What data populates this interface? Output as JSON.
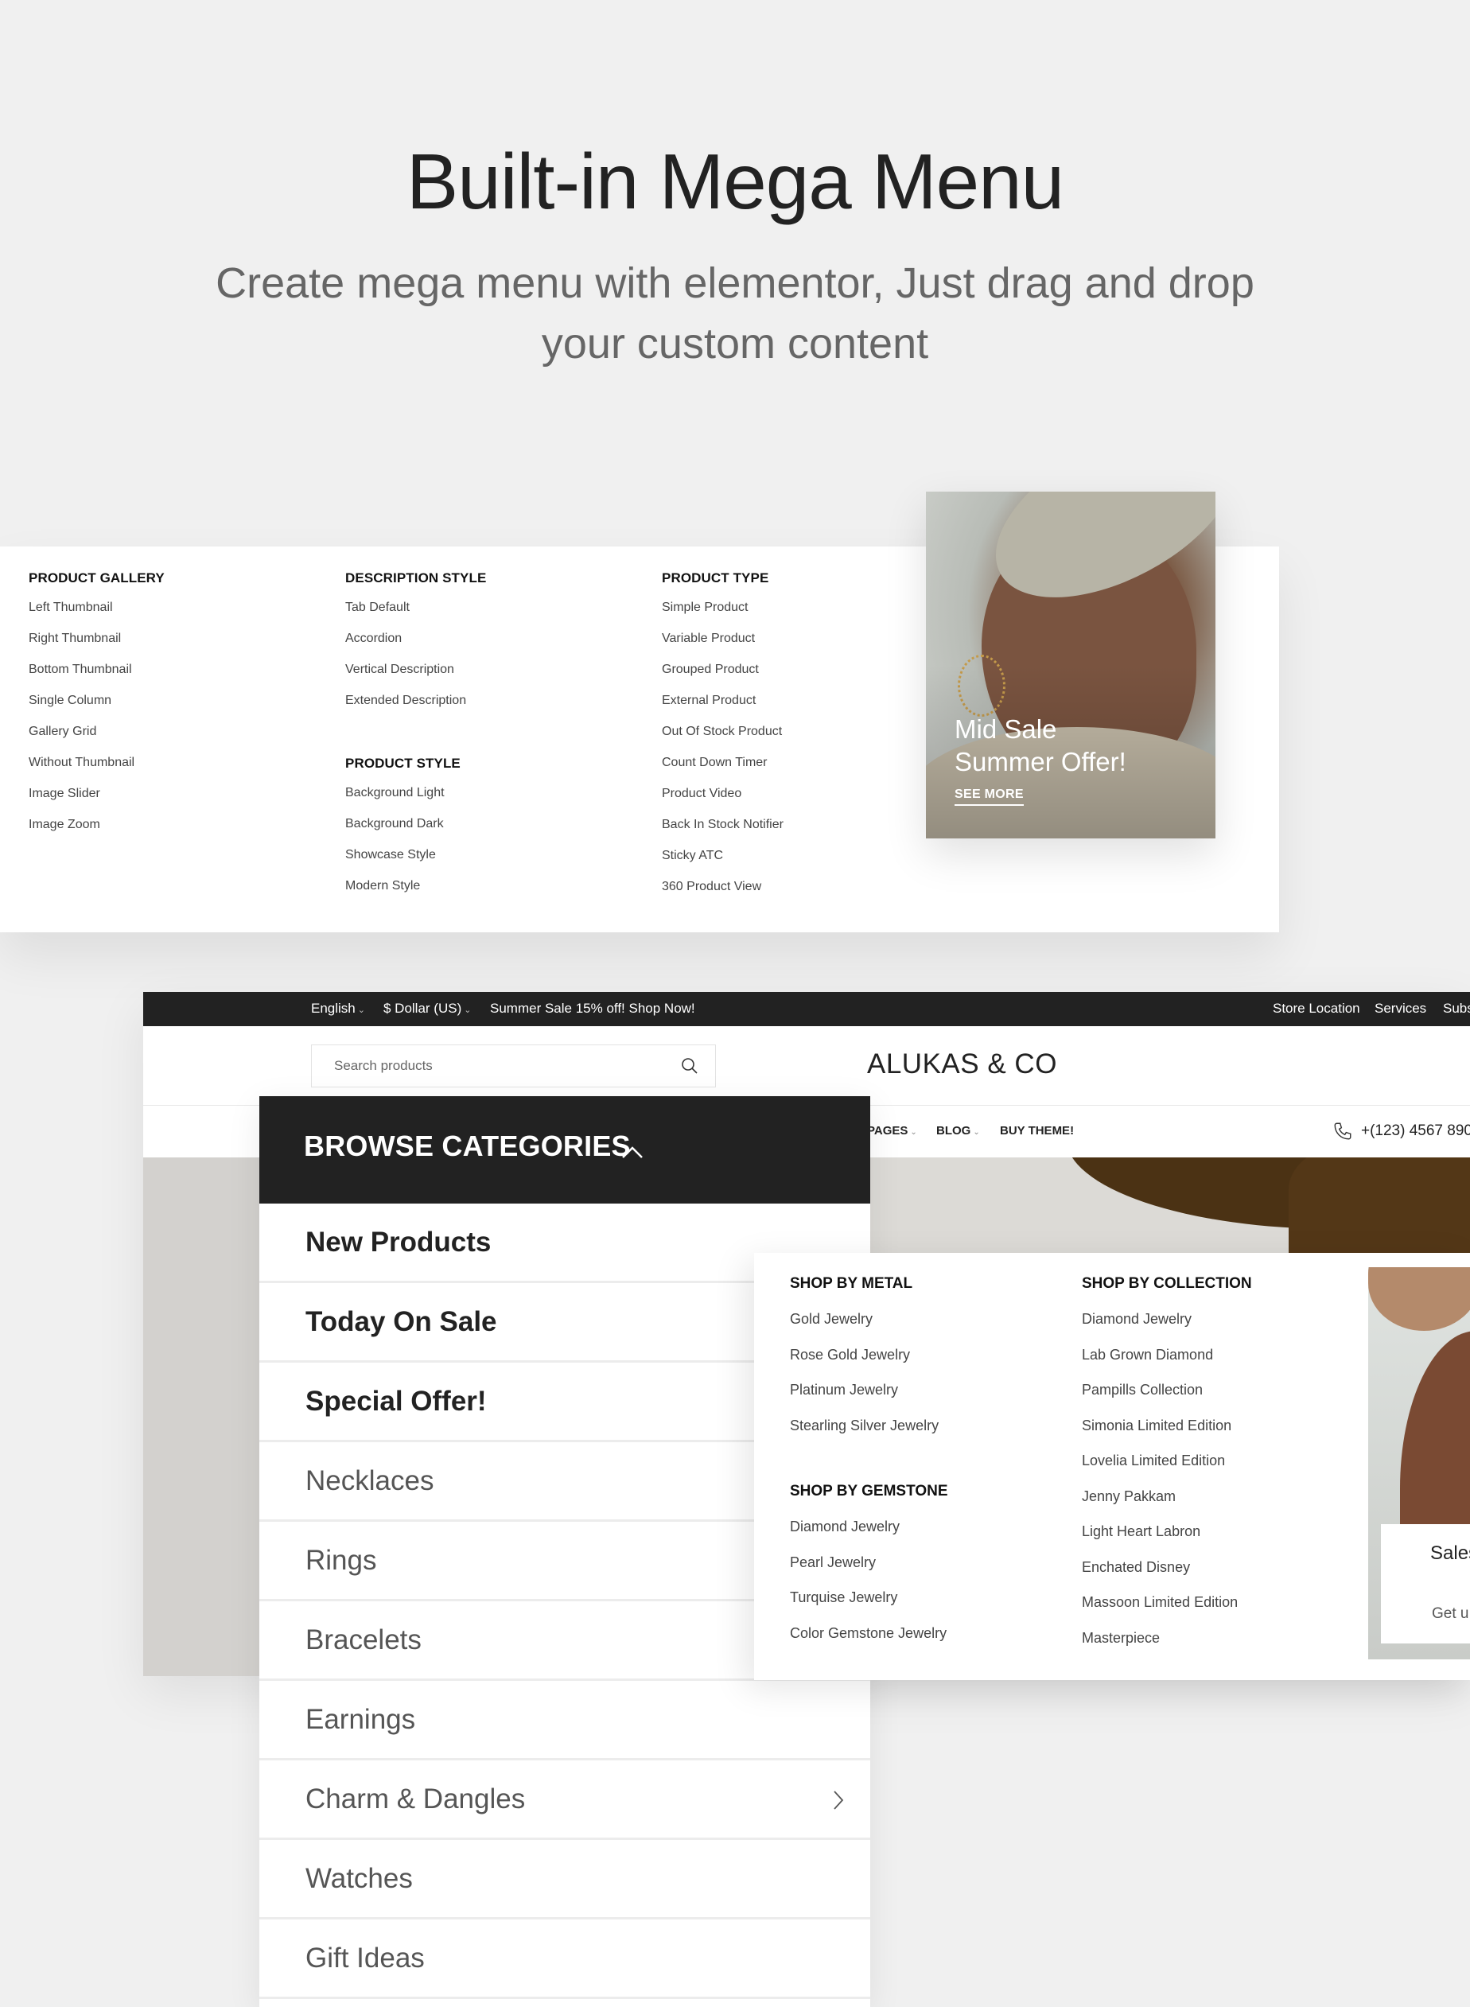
{
  "hero": {
    "title": "Built-in Mega Menu",
    "subtitle_line1": "Create mega menu with elementor, Just drag and drop",
    "subtitle_line2": "your custom content"
  },
  "mega_menu_product": {
    "columns": [
      {
        "heading": "PRODUCT GALLERY",
        "items": [
          "Left Thumbnail",
          "Right Thumbnail",
          "Bottom Thumbnail",
          "Single Column",
          "Gallery Grid",
          "Without Thumbnail",
          "Image Slider",
          "Image Zoom"
        ]
      },
      {
        "heading": "DESCRIPTION STYLE",
        "items": [
          "Tab Default",
          "Accordion",
          "Vertical Description",
          "Extended Description"
        ],
        "heading2": "PRODUCT STYLE",
        "items2": [
          "Background Light",
          "Background Dark",
          "Showcase Style",
          "Modern Style"
        ]
      },
      {
        "heading": "PRODUCT TYPE",
        "items": [
          "Simple Product",
          "Variable Product",
          "Grouped Product",
          "External Product",
          "Out Of Stock Product",
          "Count Down Timer",
          "Product Video",
          "Back In Stock Notifier",
          "Sticky ATC",
          "360 Product View"
        ]
      }
    ],
    "promo": {
      "title_line1": "Mid Sale",
      "title_line2": "Summer Offer!",
      "cta": "SEE MORE"
    }
  },
  "store": {
    "topbar": {
      "language": "English",
      "currency": "$ Dollar (US)",
      "announcement": "Summer Sale 15% off! Shop Now!",
      "links": [
        "Store Location",
        "Services",
        "Subs"
      ]
    },
    "search": {
      "placeholder": "Search products",
      "value": ""
    },
    "logo": "ALUKAS & CO",
    "nav": [
      {
        "label": "PAGES",
        "has_dropdown": true
      },
      {
        "label": "BLOG",
        "has_dropdown": true
      },
      {
        "label": "BUY THEME!",
        "has_dropdown": false
      }
    ],
    "phone": "+(123) 4567 890"
  },
  "browse_categories": {
    "label": "BROWSE CATEGORIES",
    "items": [
      {
        "label": "New Products",
        "bold": true
      },
      {
        "label": "Today On Sale",
        "bold": true
      },
      {
        "label": "Special Offer!",
        "bold": true
      },
      {
        "label": "Necklaces",
        "bold": false
      },
      {
        "label": "Rings",
        "bold": false
      },
      {
        "label": "Bracelets",
        "bold": false
      },
      {
        "label": "Earnings",
        "bold": false
      },
      {
        "label": "Charm & Dangles",
        "bold": false,
        "has_submenu": true
      },
      {
        "label": "Watches",
        "bold": false
      },
      {
        "label": "Gift Ideas",
        "bold": false
      }
    ]
  },
  "mega_menu_jewelry": {
    "columns": [
      {
        "heading": "SHOP BY METAL",
        "items": [
          "Gold Jewelry",
          "Rose Gold Jewelry",
          "Platinum Jewelry",
          "Stearling Silver Jewelry"
        ],
        "heading2": "SHOP BY GEMSTONE",
        "items2": [
          "Diamond Jewelry",
          "Pearl Jewelry",
          "Turquise Jewelry",
          "Color Gemstone Jewelry"
        ]
      },
      {
        "heading": "SHOP BY COLLECTION",
        "items": [
          "Diamond Jewelry",
          "Lab Grown Diamond",
          "Pampills Collection",
          "Simonia Limited Edition",
          "Lovelia Limited Edition",
          "Jenny Pakkam",
          "Light Heart Labron",
          "Enchated Disney",
          "Massoon Limited Edition",
          "Masterpiece"
        ]
      }
    ],
    "promo": {
      "title": "Sales",
      "text": "Get u"
    }
  },
  "colors": {
    "dark": "#222222",
    "page_bg": "#f0f0f0",
    "text_muted": "#666666"
  }
}
